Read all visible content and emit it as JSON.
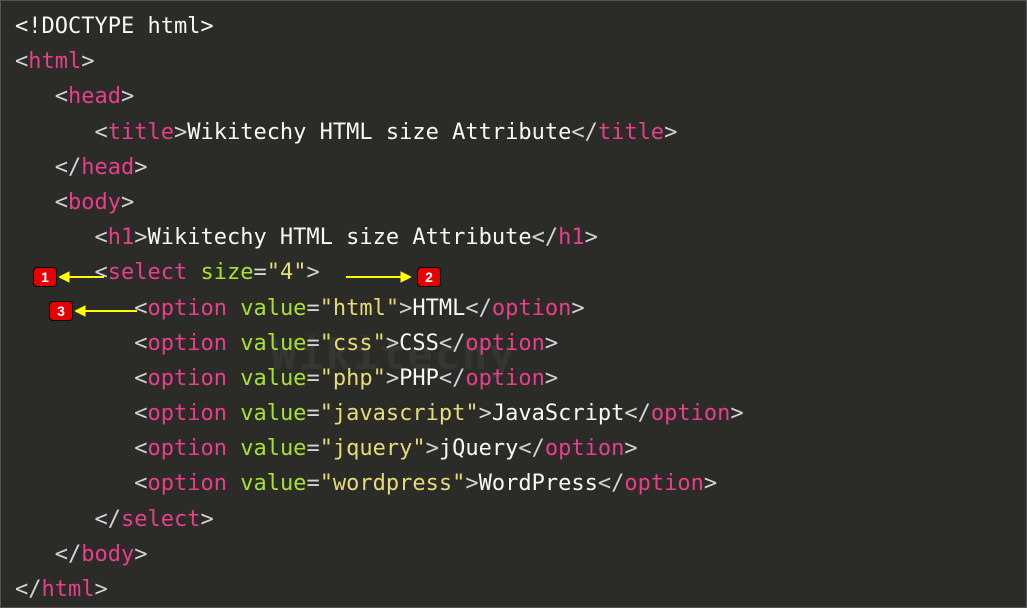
{
  "code": {
    "doctype": "<!DOCTYPE html>",
    "html_open": "html",
    "head_open": "head",
    "title_tag": "title",
    "title_text": "Wikitechy HTML size Attribute",
    "head_close": "head",
    "body_open": "body",
    "h1_tag": "h1",
    "h1_text": "Wikitechy HTML size Attribute",
    "select_tag": "select",
    "select_attr": "size",
    "select_val": "\"4\"",
    "option_tag": "option",
    "option_attr": "value",
    "options": [
      {
        "val": "\"html\"",
        "text": "HTML"
      },
      {
        "val": "\"css\"",
        "text": "CSS"
      },
      {
        "val": "\"php\"",
        "text": "PHP"
      },
      {
        "val": "\"javascript\"",
        "text": "JavaScript"
      },
      {
        "val": "\"jquery\"",
        "text": "jQuery"
      },
      {
        "val": "\"wordpress\"",
        "text": "WordPress"
      }
    ],
    "select_close": "select",
    "body_close": "body",
    "html_close": "html"
  },
  "callouts": {
    "c1": "1",
    "c2": "2",
    "c3": "3"
  },
  "watermark": "Wikitechy"
}
